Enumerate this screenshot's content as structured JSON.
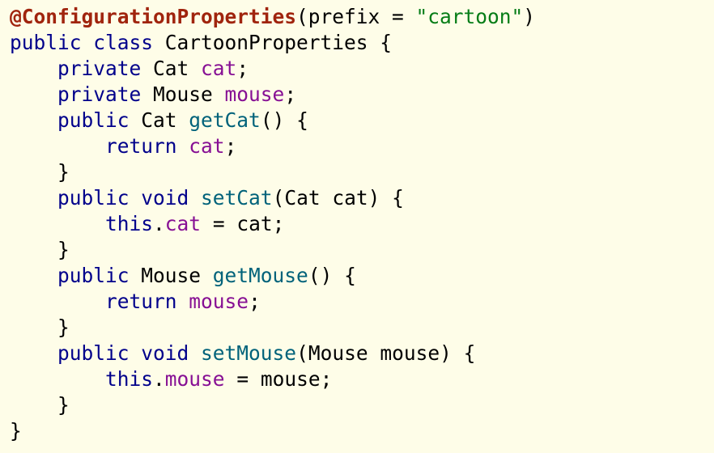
{
  "editor": {
    "background": "#fefde8",
    "colors": {
      "annotation": "#a0240d",
      "keyword": "#00008b",
      "string": "#067d17",
      "field": "#871094",
      "method": "#00627a",
      "plain": "#000000"
    },
    "lines": [
      {
        "indent": 0,
        "tokens": [
          {
            "t": "annotation",
            "v": "@ConfigurationProperties"
          },
          {
            "t": "plain",
            "v": "(prefix = "
          },
          {
            "t": "string",
            "v": "\"cartoon\""
          },
          {
            "t": "plain",
            "v": ")"
          }
        ]
      },
      {
        "indent": 0,
        "tokens": [
          {
            "t": "keyword",
            "v": "public class"
          },
          {
            "t": "plain",
            "v": " CartoonProperties {"
          }
        ]
      },
      {
        "indent": 1,
        "tokens": [
          {
            "t": "keyword",
            "v": "private"
          },
          {
            "t": "plain",
            "v": " Cat "
          },
          {
            "t": "field",
            "v": "cat"
          },
          {
            "t": "plain",
            "v": ";"
          }
        ]
      },
      {
        "indent": 1,
        "tokens": [
          {
            "t": "keyword",
            "v": "private"
          },
          {
            "t": "plain",
            "v": " Mouse "
          },
          {
            "t": "field",
            "v": "mouse"
          },
          {
            "t": "plain",
            "v": ";"
          }
        ]
      },
      {
        "indent": 1,
        "tokens": [
          {
            "t": "keyword",
            "v": "public"
          },
          {
            "t": "plain",
            "v": " Cat "
          },
          {
            "t": "method",
            "v": "getCat"
          },
          {
            "t": "plain",
            "v": "() {"
          }
        ]
      },
      {
        "indent": 2,
        "tokens": [
          {
            "t": "keyword",
            "v": "return"
          },
          {
            "t": "plain",
            "v": " "
          },
          {
            "t": "field",
            "v": "cat"
          },
          {
            "t": "plain",
            "v": ";"
          }
        ]
      },
      {
        "indent": 1,
        "tokens": [
          {
            "t": "plain",
            "v": "}"
          }
        ]
      },
      {
        "indent": 1,
        "tokens": [
          {
            "t": "keyword",
            "v": "public void"
          },
          {
            "t": "plain",
            "v": " "
          },
          {
            "t": "method",
            "v": "setCat"
          },
          {
            "t": "plain",
            "v": "(Cat cat) {"
          }
        ]
      },
      {
        "indent": 2,
        "tokens": [
          {
            "t": "keyword",
            "v": "this"
          },
          {
            "t": "plain",
            "v": "."
          },
          {
            "t": "field",
            "v": "cat"
          },
          {
            "t": "plain",
            "v": " = cat;"
          }
        ]
      },
      {
        "indent": 1,
        "tokens": [
          {
            "t": "plain",
            "v": "}"
          }
        ]
      },
      {
        "indent": 1,
        "tokens": [
          {
            "t": "keyword",
            "v": "public"
          },
          {
            "t": "plain",
            "v": " Mouse "
          },
          {
            "t": "method",
            "v": "getMouse"
          },
          {
            "t": "plain",
            "v": "() {"
          }
        ]
      },
      {
        "indent": 2,
        "tokens": [
          {
            "t": "keyword",
            "v": "return"
          },
          {
            "t": "plain",
            "v": " "
          },
          {
            "t": "field",
            "v": "mouse"
          },
          {
            "t": "plain",
            "v": ";"
          }
        ]
      },
      {
        "indent": 1,
        "tokens": [
          {
            "t": "plain",
            "v": "}"
          }
        ]
      },
      {
        "indent": 1,
        "tokens": [
          {
            "t": "keyword",
            "v": "public void"
          },
          {
            "t": "plain",
            "v": " "
          },
          {
            "t": "method",
            "v": "setMouse"
          },
          {
            "t": "plain",
            "v": "(Mouse mouse) {"
          }
        ]
      },
      {
        "indent": 2,
        "tokens": [
          {
            "t": "keyword",
            "v": "this"
          },
          {
            "t": "plain",
            "v": "."
          },
          {
            "t": "field",
            "v": "mouse"
          },
          {
            "t": "plain",
            "v": " = mouse;"
          }
        ]
      },
      {
        "indent": 1,
        "tokens": [
          {
            "t": "plain",
            "v": "}"
          }
        ]
      },
      {
        "indent": 0,
        "tokens": [
          {
            "t": "plain",
            "v": "}"
          }
        ]
      }
    ]
  }
}
